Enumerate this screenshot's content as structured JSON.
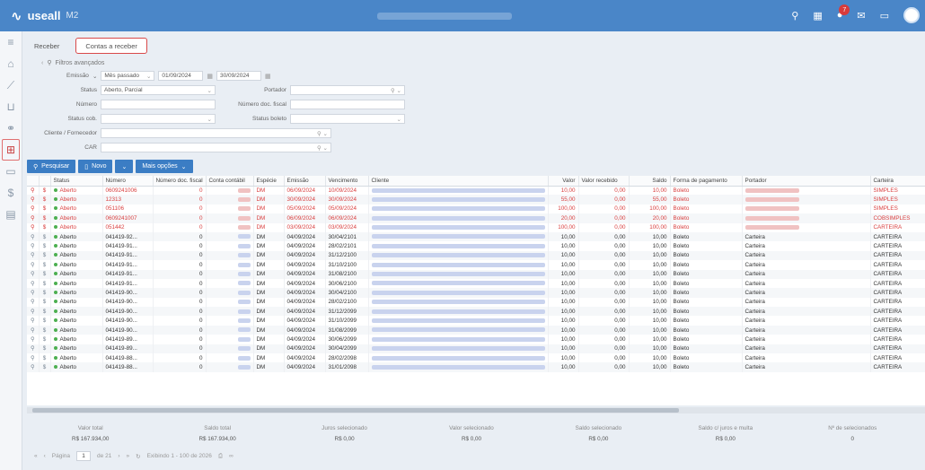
{
  "app": {
    "logo_text": "useall",
    "logo_sub": "M2",
    "notif_count": "7"
  },
  "tabs": [
    {
      "label": "Receber"
    },
    {
      "label": "Contas a receber"
    }
  ],
  "filters": {
    "advanced": "Filtros avançados",
    "emissao_label": "Emissão",
    "emissao_period": "Mês passado",
    "date_from": "01/09/2024",
    "date_to": "30/09/2024",
    "status_label": "Status",
    "status_value": "Aberto, Parcial",
    "portador_label": "Portador",
    "numero_label": "Número",
    "numero_doc_label": "Número doc. fiscal",
    "status_cob_label": "Status cob.",
    "status_boleto_label": "Status boleto",
    "cliente_label": "Cliente / Fornecedor",
    "car_label": "CAR"
  },
  "toolbar": {
    "pesquisar": "Pesquisar",
    "novo": "Novo",
    "mais": "Mais opções"
  },
  "columns": [
    "Status",
    "Número",
    "Número doc. fiscal",
    "Conta contábil",
    "Espécie",
    "Emissão",
    "Vencimento",
    "Cliente",
    "Valor",
    "Valor recebido",
    "Saldo",
    "Forma de pagamento",
    "Portador",
    "Carteira"
  ],
  "rows": [
    {
      "status": "Aberto",
      "numero": "0609241006",
      "doc": "0",
      "especie": "DM",
      "emissao": "06/09/2024",
      "venc": "10/09/2024",
      "valor": "10,00",
      "receb": "0,00",
      "saldo": "10,00",
      "forma": "Boleto",
      "portador": "",
      "carteira": "SIMPLES",
      "red": true
    },
    {
      "status": "Aberto",
      "numero": "12313",
      "doc": "0",
      "especie": "DM",
      "emissao": "30/09/2024",
      "venc": "30/09/2024",
      "valor": "55,00",
      "receb": "0,00",
      "saldo": "55,00",
      "forma": "Boleto",
      "portador": "",
      "carteira": "SIMPLES",
      "red": true
    },
    {
      "status": "Aberto",
      "numero": "051106",
      "doc": "0",
      "especie": "DM",
      "emissao": "05/09/2024",
      "venc": "05/09/2024",
      "valor": "100,00",
      "receb": "0,00",
      "saldo": "100,00",
      "forma": "Boleto",
      "portador": "",
      "carteira": "SIMPLES",
      "red": true
    },
    {
      "status": "Aberto",
      "numero": "0609241007",
      "doc": "0",
      "especie": "DM",
      "emissao": "06/09/2024",
      "venc": "06/09/2024",
      "valor": "20,00",
      "receb": "0,00",
      "saldo": "20,00",
      "forma": "Boleto",
      "portador": "",
      "carteira": "COBSIMPLES",
      "red": true
    },
    {
      "status": "Aberto",
      "numero": "051442",
      "doc": "0",
      "especie": "DM",
      "emissao": "03/09/2024",
      "venc": "03/09/2024",
      "valor": "100,00",
      "receb": "0,00",
      "saldo": "100,00",
      "forma": "Boleto",
      "portador": "",
      "carteira": "CARTEIRA",
      "red": true
    },
    {
      "status": "Aberto",
      "numero": "041419-92...",
      "doc": "0",
      "especie": "DM",
      "emissao": "04/09/2024",
      "venc": "30/04/2101",
      "valor": "10,00",
      "receb": "0,00",
      "saldo": "10,00",
      "forma": "Boleto",
      "portador": "Carteira",
      "carteira": "CARTEIRA",
      "red": false
    },
    {
      "status": "Aberto",
      "numero": "041419-91...",
      "doc": "0",
      "especie": "DM",
      "emissao": "04/09/2024",
      "venc": "28/02/2101",
      "valor": "10,00",
      "receb": "0,00",
      "saldo": "10,00",
      "forma": "Boleto",
      "portador": "Carteira",
      "carteira": "CARTEIRA",
      "red": false
    },
    {
      "status": "Aberto",
      "numero": "041419-91...",
      "doc": "0",
      "especie": "DM",
      "emissao": "04/09/2024",
      "venc": "31/12/2100",
      "valor": "10,00",
      "receb": "0,00",
      "saldo": "10,00",
      "forma": "Boleto",
      "portador": "Carteira",
      "carteira": "CARTEIRA",
      "red": false
    },
    {
      "status": "Aberto",
      "numero": "041419-91...",
      "doc": "0",
      "especie": "DM",
      "emissao": "04/09/2024",
      "venc": "31/10/2100",
      "valor": "10,00",
      "receb": "0,00",
      "saldo": "10,00",
      "forma": "Boleto",
      "portador": "Carteira",
      "carteira": "CARTEIRA",
      "red": false
    },
    {
      "status": "Aberto",
      "numero": "041419-91...",
      "doc": "0",
      "especie": "DM",
      "emissao": "04/09/2024",
      "venc": "31/08/2100",
      "valor": "10,00",
      "receb": "0,00",
      "saldo": "10,00",
      "forma": "Boleto",
      "portador": "Carteira",
      "carteira": "CARTEIRA",
      "red": false
    },
    {
      "status": "Aberto",
      "numero": "041419-91...",
      "doc": "0",
      "especie": "DM",
      "emissao": "04/09/2024",
      "venc": "30/06/2100",
      "valor": "10,00",
      "receb": "0,00",
      "saldo": "10,00",
      "forma": "Boleto",
      "portador": "Carteira",
      "carteira": "CARTEIRA",
      "red": false
    },
    {
      "status": "Aberto",
      "numero": "041419-90...",
      "doc": "0",
      "especie": "DM",
      "emissao": "04/09/2024",
      "venc": "30/04/2100",
      "valor": "10,00",
      "receb": "0,00",
      "saldo": "10,00",
      "forma": "Boleto",
      "portador": "Carteira",
      "carteira": "CARTEIRA",
      "red": false
    },
    {
      "status": "Aberto",
      "numero": "041419-90...",
      "doc": "0",
      "especie": "DM",
      "emissao": "04/09/2024",
      "venc": "28/02/2100",
      "valor": "10,00",
      "receb": "0,00",
      "saldo": "10,00",
      "forma": "Boleto",
      "portador": "Carteira",
      "carteira": "CARTEIRA",
      "red": false
    },
    {
      "status": "Aberto",
      "numero": "041419-90...",
      "doc": "0",
      "especie": "DM",
      "emissao": "04/09/2024",
      "venc": "31/12/2099",
      "valor": "10,00",
      "receb": "0,00",
      "saldo": "10,00",
      "forma": "Boleto",
      "portador": "Carteira",
      "carteira": "CARTEIRA",
      "red": false
    },
    {
      "status": "Aberto",
      "numero": "041419-90...",
      "doc": "0",
      "especie": "DM",
      "emissao": "04/09/2024",
      "venc": "31/10/2099",
      "valor": "10,00",
      "receb": "0,00",
      "saldo": "10,00",
      "forma": "Boleto",
      "portador": "Carteira",
      "carteira": "CARTEIRA",
      "red": false
    },
    {
      "status": "Aberto",
      "numero": "041419-90...",
      "doc": "0",
      "especie": "DM",
      "emissao": "04/09/2024",
      "venc": "31/08/2099",
      "valor": "10,00",
      "receb": "0,00",
      "saldo": "10,00",
      "forma": "Boleto",
      "portador": "Carteira",
      "carteira": "CARTEIRA",
      "red": false
    },
    {
      "status": "Aberto",
      "numero": "041419-89...",
      "doc": "0",
      "especie": "DM",
      "emissao": "04/09/2024",
      "venc": "30/06/2099",
      "valor": "10,00",
      "receb": "0,00",
      "saldo": "10,00",
      "forma": "Boleto",
      "portador": "Carteira",
      "carteira": "CARTEIRA",
      "red": false
    },
    {
      "status": "Aberto",
      "numero": "041419-89...",
      "doc": "0",
      "especie": "DM",
      "emissao": "04/09/2024",
      "venc": "30/04/2099",
      "valor": "10,00",
      "receb": "0,00",
      "saldo": "10,00",
      "forma": "Boleto",
      "portador": "Carteira",
      "carteira": "CARTEIRA",
      "red": false
    },
    {
      "status": "Aberto",
      "numero": "041419-88...",
      "doc": "0",
      "especie": "DM",
      "emissao": "04/09/2024",
      "venc": "28/02/2098",
      "valor": "10,00",
      "receb": "0,00",
      "saldo": "10,00",
      "forma": "Boleto",
      "portador": "Carteira",
      "carteira": "CARTEIRA",
      "red": false
    },
    {
      "status": "Aberto",
      "numero": "041419-88...",
      "doc": "0",
      "especie": "DM",
      "emissao": "04/09/2024",
      "venc": "31/01/2098",
      "valor": "10,00",
      "receb": "0,00",
      "saldo": "10,00",
      "forma": "Boleto",
      "portador": "Carteira",
      "carteira": "CARTEIRA",
      "red": false
    }
  ],
  "totals": [
    {
      "label": "Valor total",
      "value": "R$ 167.934,00"
    },
    {
      "label": "Saldo total",
      "value": "R$ 167.934,00"
    },
    {
      "label": "Juros selecionado",
      "value": "R$ 0,00"
    },
    {
      "label": "Valor selecionado",
      "value": "R$ 0,00"
    },
    {
      "label": "Saldo selecionado",
      "value": "R$ 0,00"
    },
    {
      "label": "Saldo c/ juros e multa",
      "value": "R$ 0,00"
    },
    {
      "label": "Nº de selecionados",
      "value": "0"
    }
  ],
  "pager": {
    "pagina": "Página",
    "page": "1",
    "de": "de 21",
    "exibindo": "Exibindo 1 - 100 de 2026"
  }
}
